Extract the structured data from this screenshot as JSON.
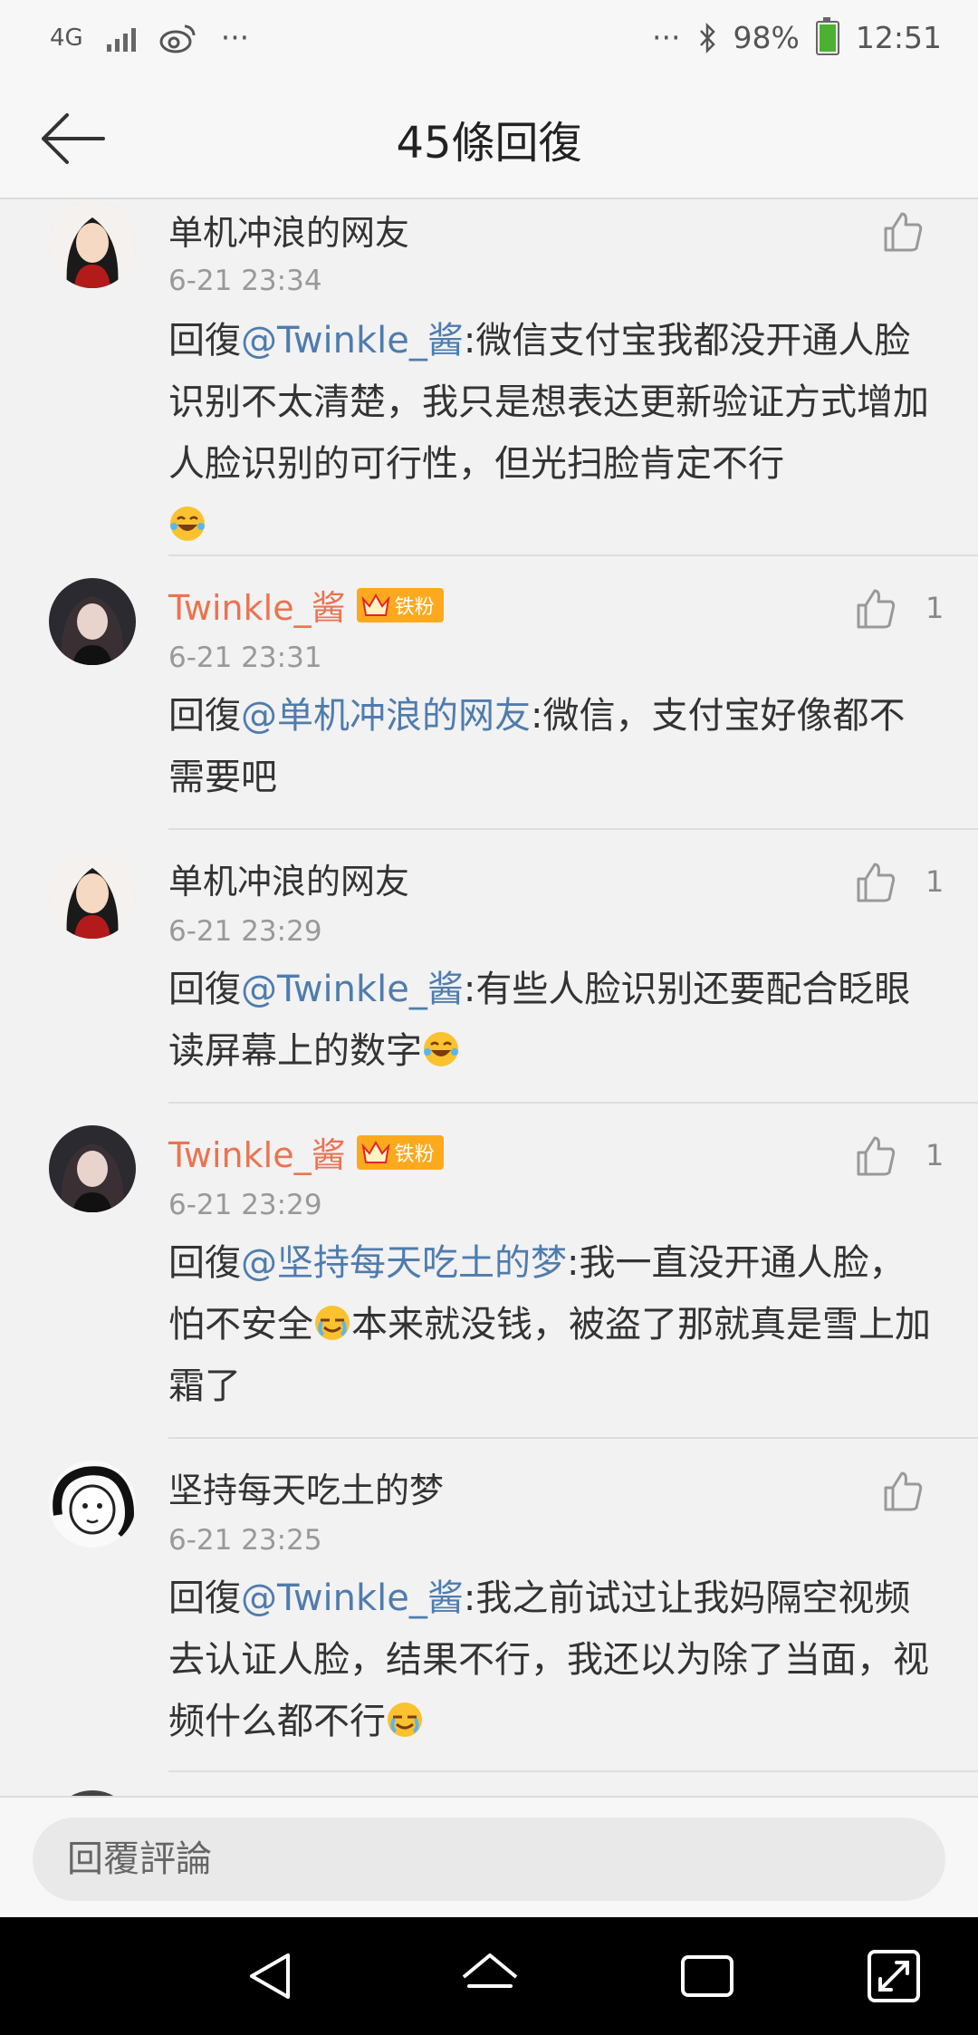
{
  "status_bar": {
    "network": "4G",
    "battery": "98%",
    "time": "12:51",
    "more": "···"
  },
  "header": {
    "title": "45條回復"
  },
  "comments": [
    {
      "user": "单机冲浪的网友",
      "time": "6-21 23:34",
      "reply_prefix": "回復",
      "mention": "@Twinkle_酱",
      "text": ":微信支付宝我都没开通人脸识别不太清楚，我只是想表达更新验证方式增加人脸识别的可行性，但光扫脸肯定不行",
      "likes": ""
    },
    {
      "user": "Twinkle_酱",
      "badge": "铁粉",
      "time": "6-21 23:31",
      "reply_prefix": "回復",
      "mention": "@单机冲浪的网友",
      "text": ":微信，支付宝好像都不需要吧",
      "likes": "1"
    },
    {
      "user": "单机冲浪的网友",
      "time": "6-21 23:29",
      "reply_prefix": "回復",
      "mention": "@Twinkle_酱",
      "text": ":有些人脸识别还要配合眨眼读屏幕上的数字",
      "likes": "1"
    },
    {
      "user": "Twinkle_酱",
      "badge": "铁粉",
      "time": "6-21 23:29",
      "reply_prefix": "回復",
      "mention": "@坚持每天吃土的梦",
      "text": ":我一直没开通人脸，怕不安全",
      "text2": "本来就没钱，被盗了那就真是雪上加霜了",
      "likes": "1"
    },
    {
      "user": "坚持每天吃土的梦",
      "time": "6-21 23:25",
      "reply_prefix": "回復",
      "mention": "@Twinkle_酱",
      "text": ":我之前试过让我妈隔空视频去认证人脸，结果不行，我还以为除了当面，视频什么都不行",
      "likes": ""
    }
  ],
  "reply_bar": {
    "placeholder": "回覆評論"
  },
  "colors": {
    "username_highlight": "#eb7350",
    "mention": "#4f7cae",
    "badge": "#fda91e"
  }
}
